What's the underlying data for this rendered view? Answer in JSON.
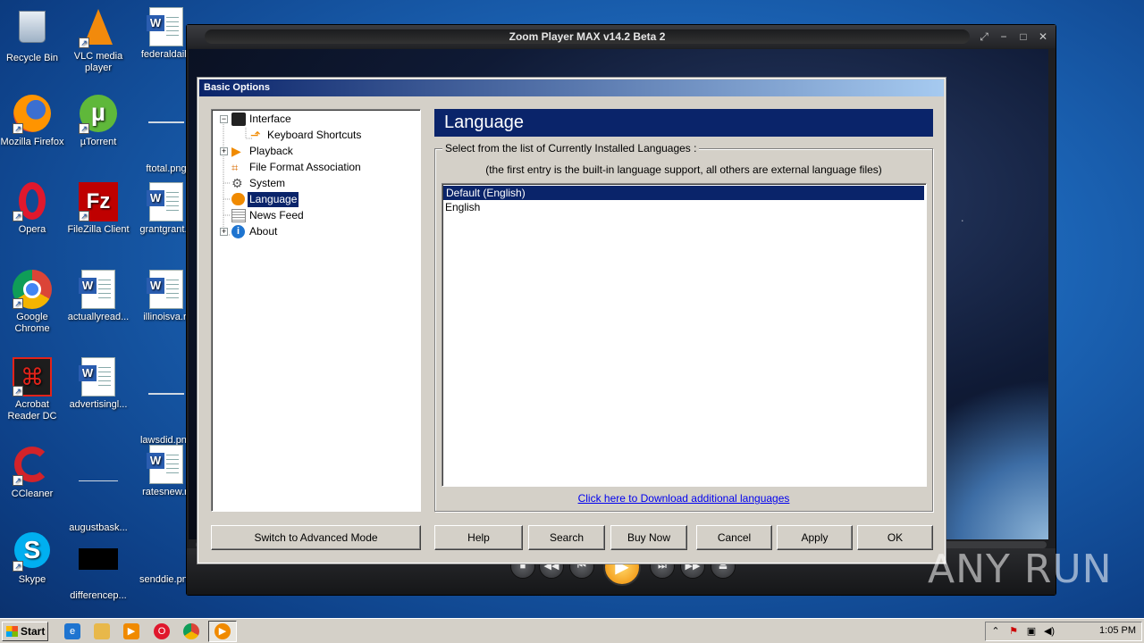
{
  "desktop": {
    "icons": [
      {
        "label": "Recycle Bin"
      },
      {
        "label": "VLC media player"
      },
      {
        "label": "federaldaily"
      },
      {
        "label": "Mozilla Firefox"
      },
      {
        "label": "µTorrent"
      },
      {
        "label": "ftotal.png"
      },
      {
        "label": "Opera"
      },
      {
        "label": "FileZilla Client"
      },
      {
        "label": "grantgrant..."
      },
      {
        "label": "Google Chrome"
      },
      {
        "label": "actuallyread..."
      },
      {
        "label": "illinoisva.rt"
      },
      {
        "label": "Acrobat Reader DC"
      },
      {
        "label": "advertisingl..."
      },
      {
        "label": "lawsdid.png"
      },
      {
        "label": "CCleaner"
      },
      {
        "label": "augustbask..."
      },
      {
        "label": "ratesnew.rt"
      },
      {
        "label": "Skype"
      },
      {
        "label": "differencep..."
      },
      {
        "label": "senddie.png"
      }
    ]
  },
  "player": {
    "title": "Zoom Player MAX v14.2 Beta 2"
  },
  "dialog": {
    "title": "Basic Options",
    "tree": [
      {
        "label": "Interface",
        "expander": "−"
      },
      {
        "label": "Keyboard Shortcuts"
      },
      {
        "label": "Playback",
        "expander": "+"
      },
      {
        "label": "File Format Association"
      },
      {
        "label": "System"
      },
      {
        "label": "Language"
      },
      {
        "label": "News Feed"
      },
      {
        "label": "About",
        "expander": "+"
      }
    ],
    "selected_item": "Language",
    "panel_title": "Language",
    "group_legend": "Select from the list of Currently Installed Languages :",
    "hint": "(the first entry is the built-in language support, all others are external language files)",
    "languages": [
      "Default (English)",
      "English"
    ],
    "selected_language": "Default (English)",
    "download_link": "Click here to Download additional languages",
    "buttons": {
      "advanced": "Switch to Advanced Mode",
      "help": "Help",
      "search": "Search",
      "buy": "Buy Now",
      "cancel": "Cancel",
      "apply": "Apply",
      "ok": "OK"
    }
  },
  "taskbar": {
    "start": "Start",
    "clock": "1:05 PM"
  },
  "watermark": "ANY RUN",
  "colors": {
    "selection": "#0a246a",
    "dialog_bg": "#d4d0c8",
    "link": "#0000ee"
  }
}
